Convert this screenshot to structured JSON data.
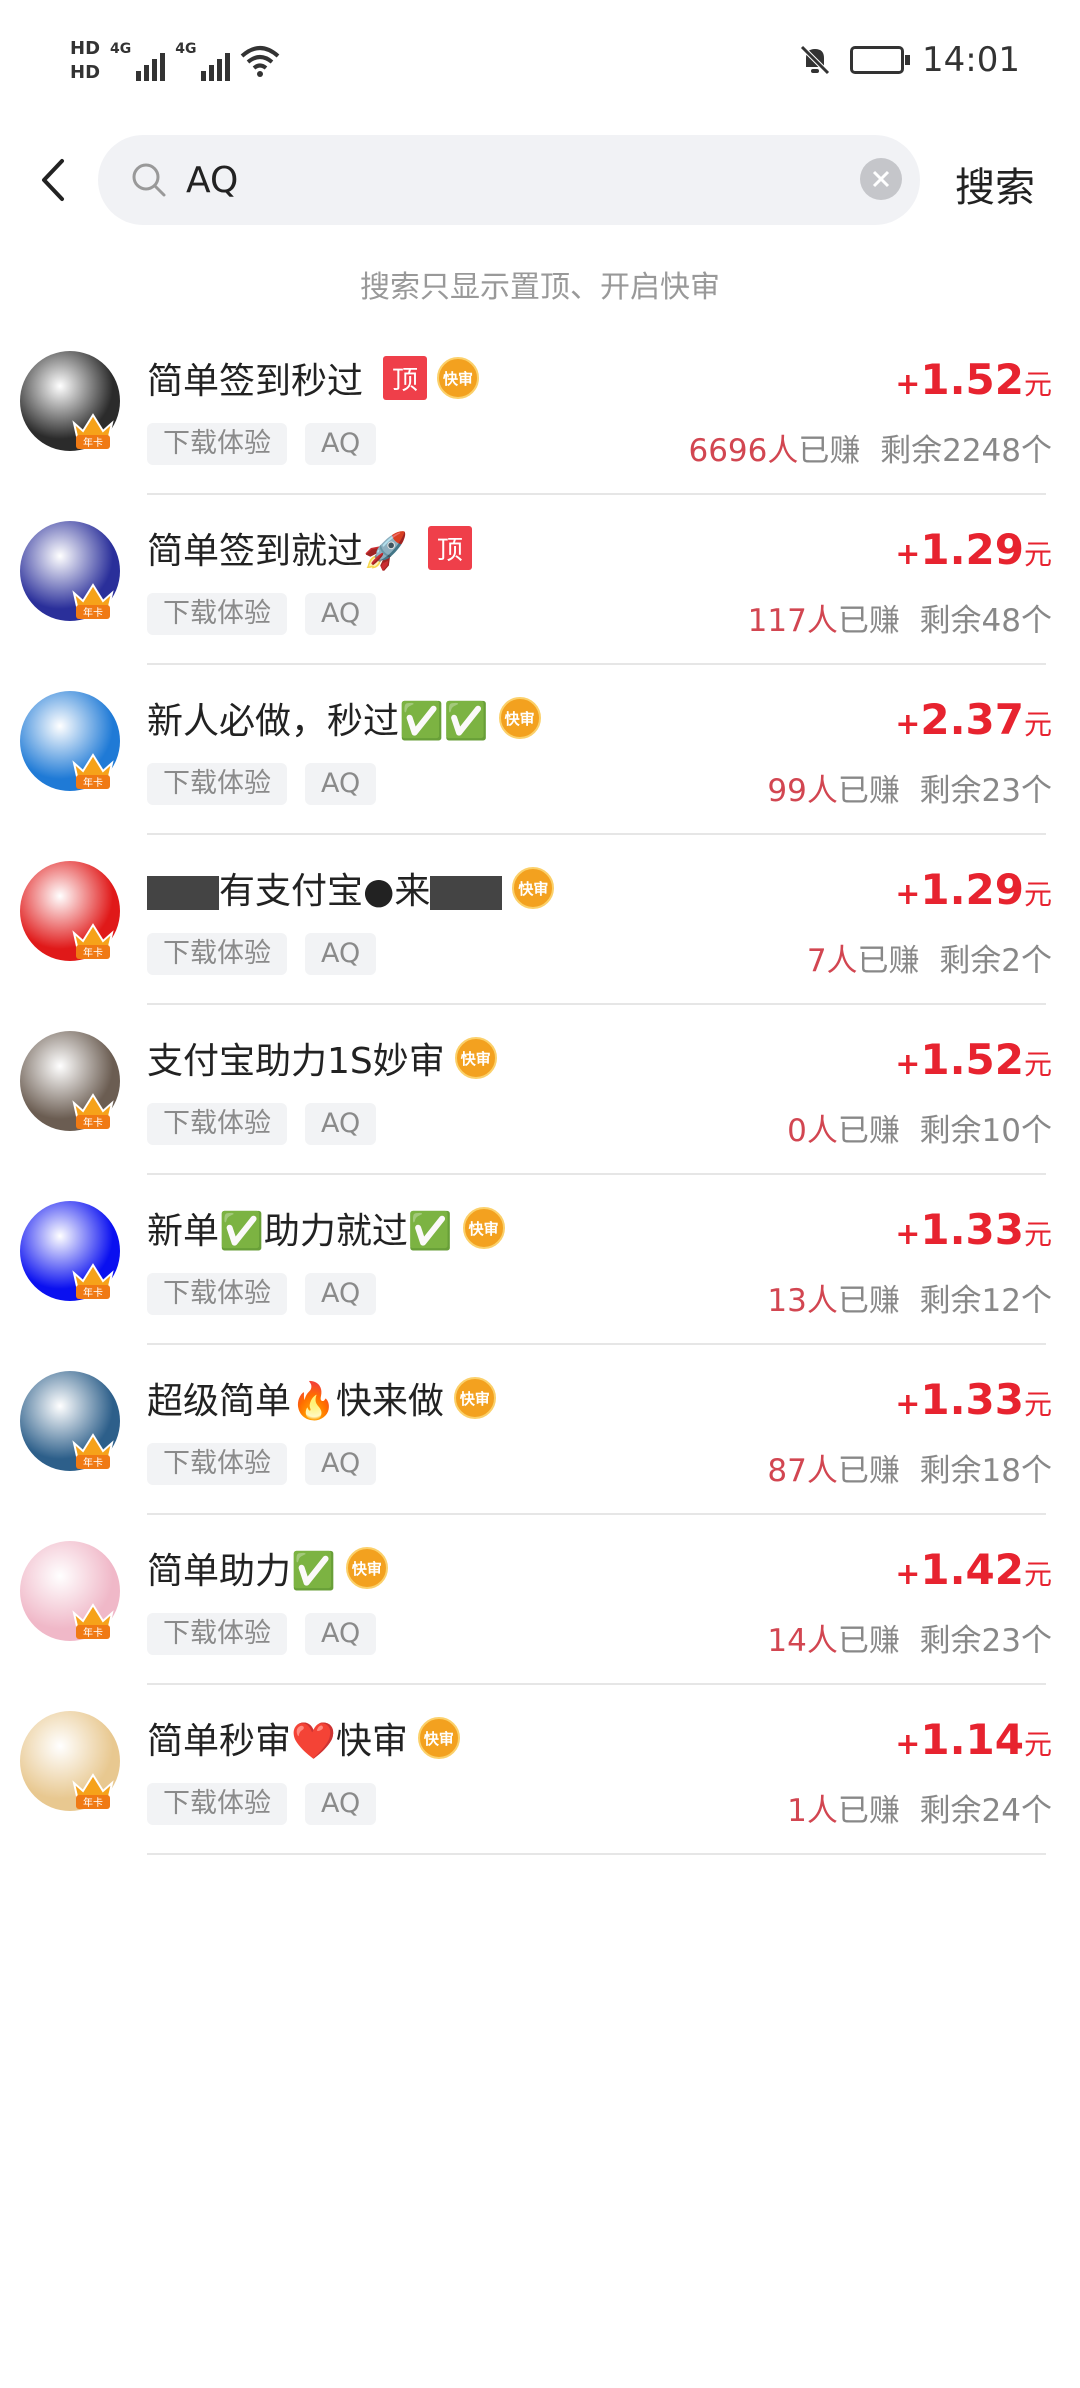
{
  "status_bar": {
    "hd1": "HD",
    "hd2": "HD",
    "net1": "4G",
    "net2": "4G",
    "time": "14:01"
  },
  "search": {
    "query": "AQ",
    "button_label": "搜索",
    "hint": "搜索只显示置顶、开启快审"
  },
  "labels": {
    "top_badge": "顶",
    "fast_badge": "快审",
    "crown_label": "年卡",
    "earned_suffix": "已赚",
    "currency": "元"
  },
  "items": [
    {
      "title": "简单签到秒过",
      "top": true,
      "fast": true,
      "tags": [
        "下载体验",
        "AQ"
      ],
      "amount": "1.52",
      "earned": "6696人",
      "remaining": "剩余2248个",
      "avatar_color": "#2b2b2b"
    },
    {
      "title": "简单签到就过🚀",
      "top": true,
      "fast": false,
      "tags": [
        "下载体验",
        "AQ"
      ],
      "amount": "1.29",
      "earned": "117人",
      "remaining": "剩余48个",
      "avatar_color": "#2a2f9a"
    },
    {
      "title": "新人必做，秒过✅✅",
      "top": false,
      "fast": true,
      "tags": [
        "下载体验",
        "AQ"
      ],
      "amount": "2.37",
      "earned": "99人",
      "remaining": "剩余23个",
      "avatar_color": "#1f7ad6"
    },
    {
      "title_parts": [
        "有支付宝●来"
      ],
      "title": "有支付宝●来",
      "redacted": true,
      "top": false,
      "fast": true,
      "tags": [
        "下载体验",
        "AQ"
      ],
      "amount": "1.29",
      "earned": "7人",
      "remaining": "剩余2个",
      "avatar_color": "#e01919"
    },
    {
      "title": "支付宝助力1S妙审",
      "top": false,
      "fast": true,
      "tags": [
        "下载体验",
        "AQ"
      ],
      "amount": "1.52",
      "earned": "0人",
      "remaining": "剩余10个",
      "avatar_color": "#6b5d52"
    },
    {
      "title": "新单✅助力就过✅",
      "top": false,
      "fast": true,
      "tags": [
        "下载体验",
        "AQ"
      ],
      "amount": "1.33",
      "earned": "13人",
      "remaining": "剩余12个",
      "avatar_color": "#0a10f0"
    },
    {
      "title": "超级简单🔥快来做",
      "top": false,
      "fast": true,
      "tags": [
        "下载体验",
        "AQ"
      ],
      "amount": "1.33",
      "earned": "87人",
      "remaining": "剩余18个",
      "avatar_color": "#2d5f8a"
    },
    {
      "title": "简单助力✅",
      "top": false,
      "fast": true,
      "tags": [
        "下载体验",
        "AQ"
      ],
      "amount": "1.42",
      "earned": "14人",
      "remaining": "剩余23个",
      "avatar_color": "#f0b8c8"
    },
    {
      "title": "简单秒审❤️快审",
      "top": false,
      "fast": true,
      "tags": [
        "下载体验",
        "AQ"
      ],
      "amount": "1.14",
      "earned": "1人",
      "remaining": "剩余24个",
      "avatar_color": "#e8c890"
    }
  ],
  "colors": {
    "accent": "#e7232f",
    "badge_red": "#ef3f4a",
    "badge_orange": "#f3a11f"
  }
}
